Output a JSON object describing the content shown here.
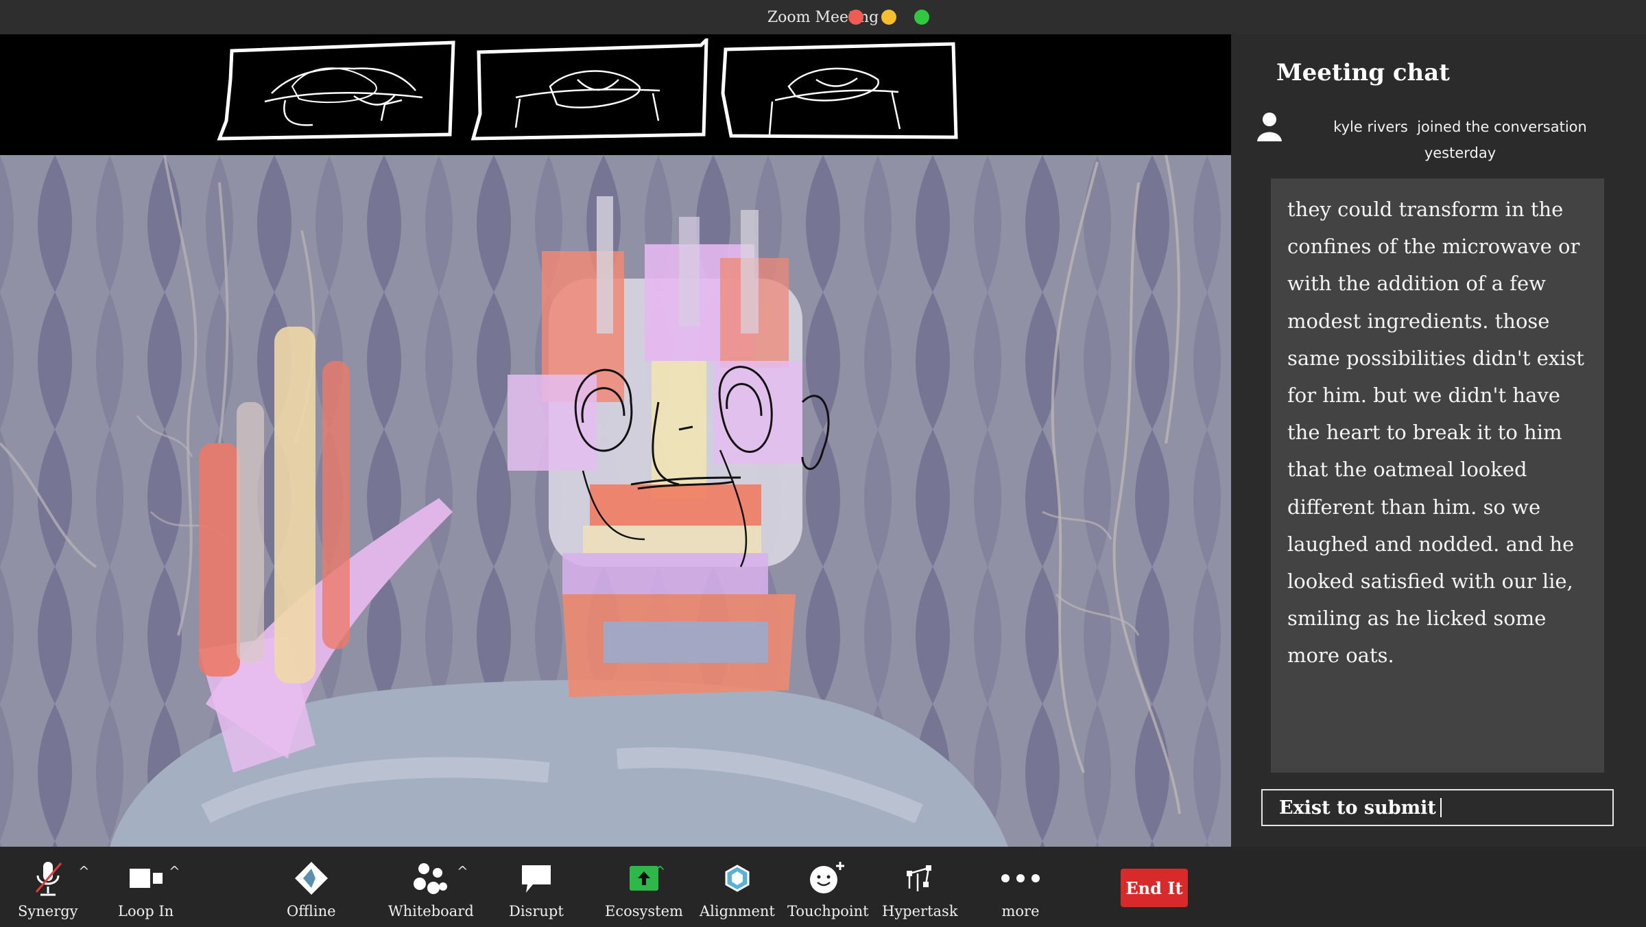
{
  "window": {
    "title": "Zoom Meeting"
  },
  "chat": {
    "title": "Meeting chat",
    "join_name": "kyle rivers",
    "join_text": "joined the conversation",
    "join_time": "yesterday",
    "message": "they could transform in the confines of the microwave or with the addition of a few modest ingredients. those same possibilities didn't exist for him. but we didn't have the heart to break it to him that the oatmeal looked different than him. so we laughed and nodded. and he looked satisfied with our lie, smiling as he licked some more oats.",
    "input_value": "Exist to submit"
  },
  "toolbar": {
    "items": [
      {
        "label": "Synergy",
        "icon": "microphone-muted-icon"
      },
      {
        "label": "Loop In",
        "icon": "video-camera-icon"
      },
      {
        "label": "Offline",
        "icon": "diamond-icon"
      },
      {
        "label": "Whiteboard",
        "icon": "participants-icon"
      },
      {
        "label": "Disrupt",
        "icon": "speech-bubble-icon"
      },
      {
        "label": "Ecosystem",
        "icon": "share-screen-icon"
      },
      {
        "label": "Alignment",
        "icon": "hexagon-icon"
      },
      {
        "label": "Touchpoint",
        "icon": "smiley-add-icon"
      },
      {
        "label": "Hypertask",
        "icon": "hypertask-icon"
      },
      {
        "label": "more",
        "icon": "more-dots-icon"
      }
    ],
    "end_label": "End It"
  },
  "colors": {
    "accent_green": "#2fb84a",
    "end_red": "#d82a2a",
    "stage_bg": "#8c8ba3"
  }
}
